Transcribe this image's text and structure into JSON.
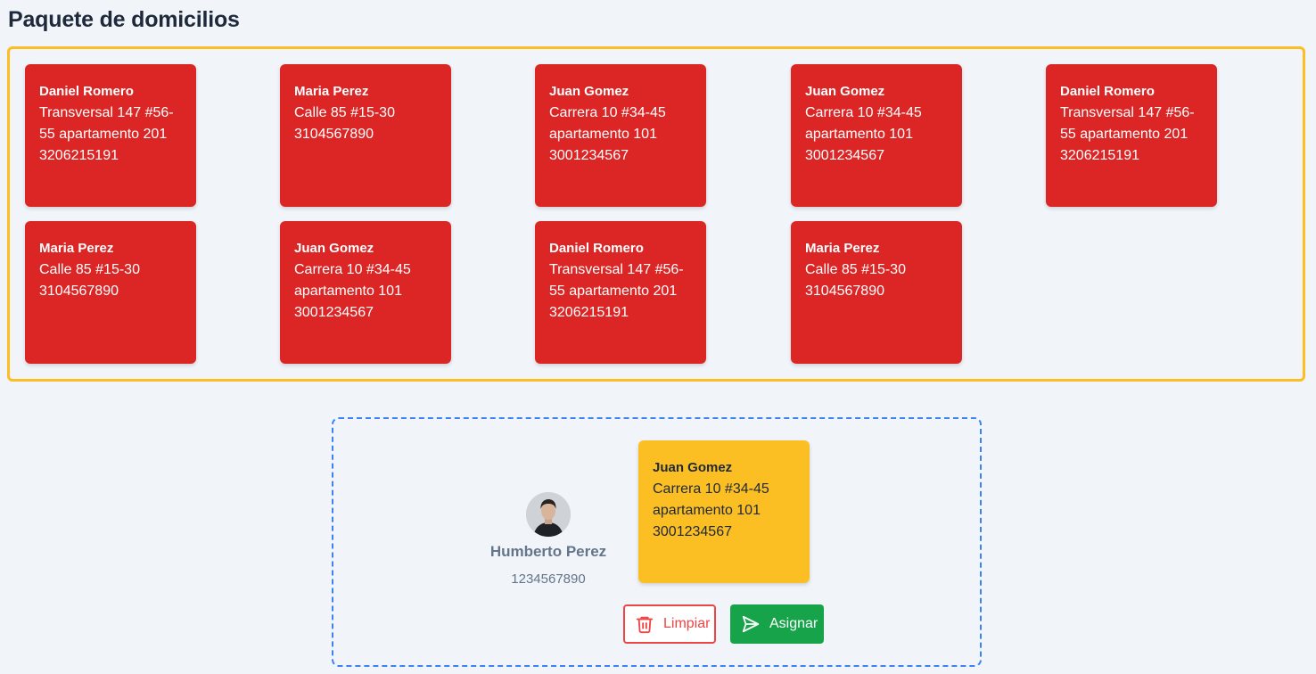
{
  "page": {
    "title": "Paquete de domicilios"
  },
  "package": {
    "cards": [
      {
        "name": "Daniel Romero",
        "lines": [
          "Transversal 147 #56-",
          "55 apartamento 201",
          "3206215191"
        ]
      },
      {
        "name": "Maria Perez",
        "lines": [
          "Calle 85 #15-30",
          "3104567890",
          ""
        ]
      },
      {
        "name": "Juan Gomez",
        "lines": [
          "Carrera 10 #34-45",
          "apartamento 101",
          "3001234567"
        ]
      },
      {
        "name": "Juan Gomez",
        "lines": [
          "Carrera 10 #34-45",
          "apartamento 101",
          "3001234567"
        ]
      },
      {
        "name": "Daniel Romero",
        "lines": [
          "Transversal 147 #56-",
          "55 apartamento 201",
          "3206215191"
        ]
      },
      {
        "name": "Maria Perez",
        "lines": [
          "Calle 85 #15-30",
          "3104567890",
          ""
        ]
      },
      {
        "name": "Juan Gomez",
        "lines": [
          "Carrera 10 #34-45",
          "apartamento 101",
          "3001234567"
        ]
      },
      {
        "name": "Daniel Romero",
        "lines": [
          "Transversal 147 #56-",
          "55 apartamento 201",
          "3206215191"
        ]
      },
      {
        "name": "Maria Perez",
        "lines": [
          "Calle 85 #15-30",
          "3104567890",
          ""
        ]
      }
    ]
  },
  "assignment": {
    "courier": {
      "name": "Humberto Perez",
      "phone": "1234567890",
      "avatar_icon": "avatar-photo"
    },
    "assigned_card": {
      "name": "Juan Gomez",
      "lines": [
        "Carrera 10 #34-45",
        "apartamento 101",
        "3001234567"
      ]
    },
    "buttons": {
      "clear_label": "Limpiar",
      "clear_icon": "trash-icon",
      "assign_label": "Asignar",
      "assign_icon": "send-icon"
    }
  },
  "colors": {
    "card_unassigned": "#dc2626",
    "card_assigned": "#fbbf24",
    "package_border": "#fbbf24",
    "dropzone_border": "#3b82f6",
    "clear_button": "#ef4444",
    "assign_button": "#16a34a"
  }
}
